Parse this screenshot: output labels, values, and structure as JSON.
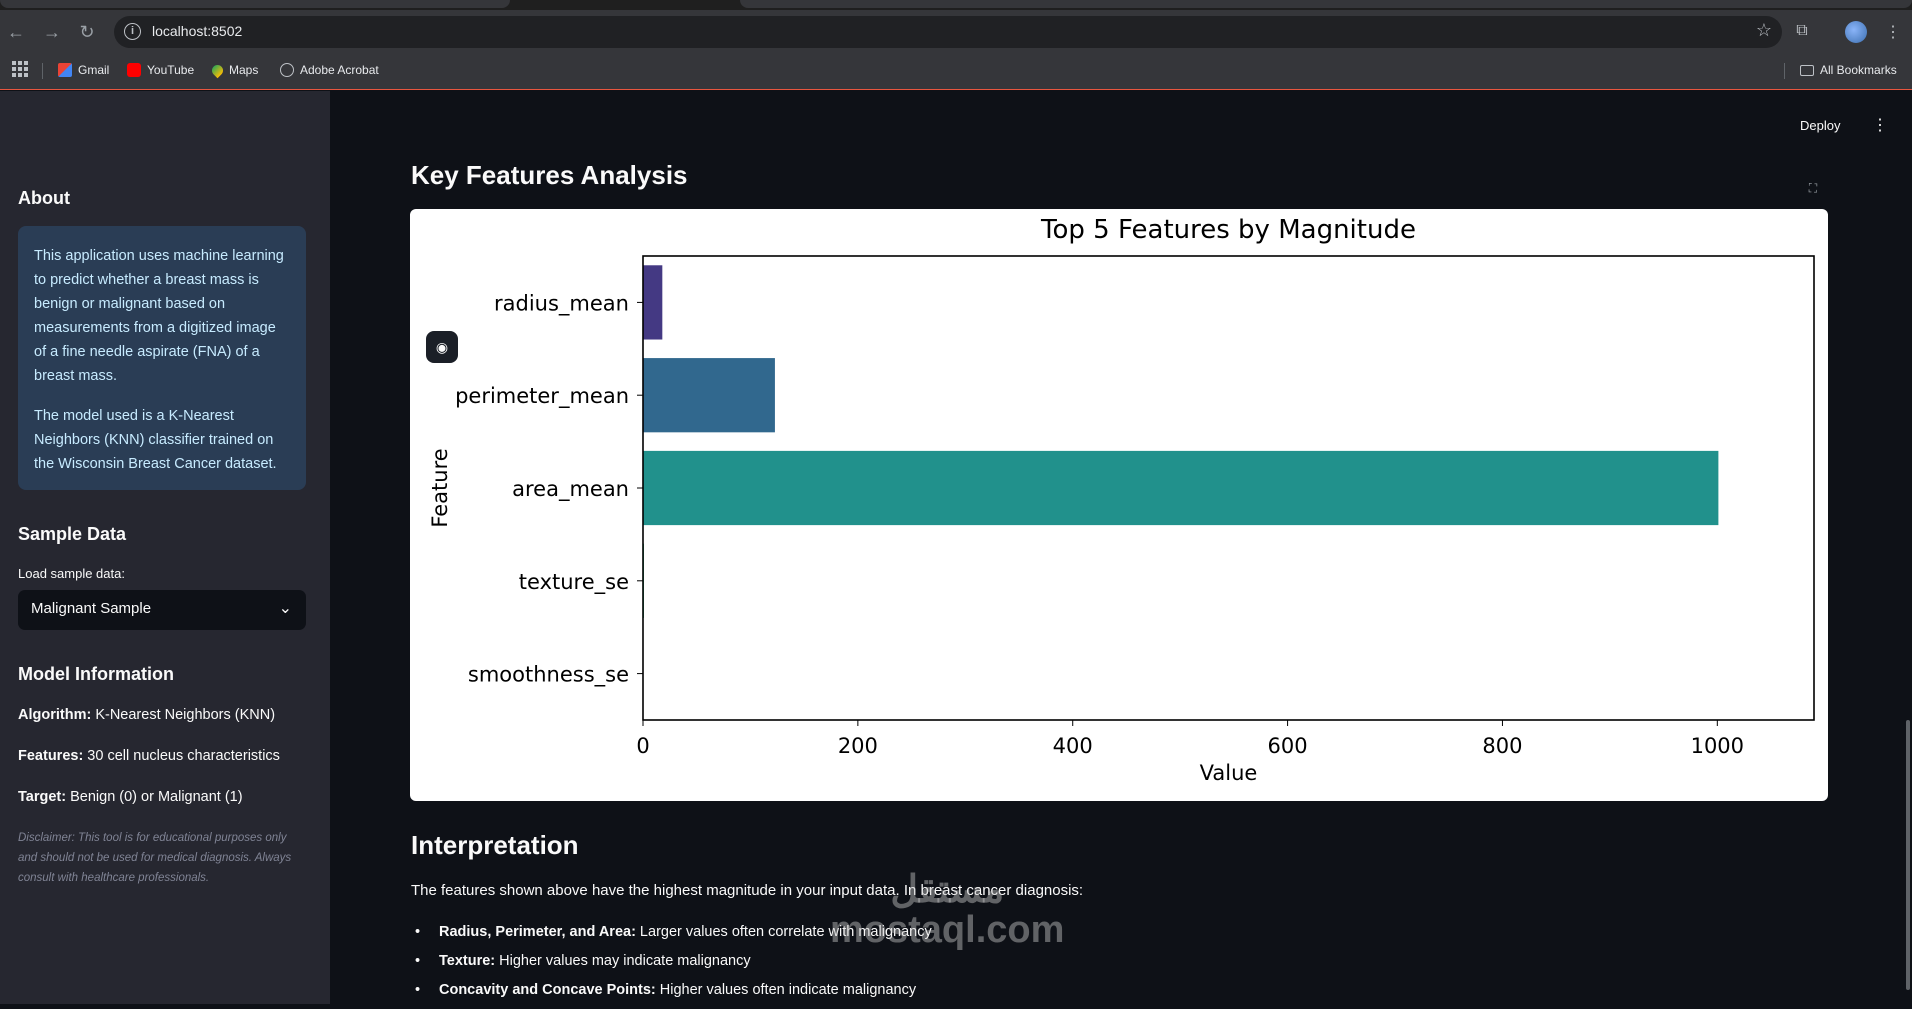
{
  "browser": {
    "url": "localhost:8502",
    "bookmarks": [
      "Gmail",
      "YouTube",
      "Maps",
      "Adobe Acrobat"
    ],
    "all_bookmarks": "All Bookmarks"
  },
  "header": {
    "deploy": "Deploy"
  },
  "sidebar": {
    "about_title": "About",
    "about_p1": "This application uses machine learning to predict whether a breast mass is benign or malignant based on measurements from a digitized image of a fine needle aspirate (FNA) of a breast mass.",
    "about_p2": "The model used is a K-Nearest Neighbors (KNN) classifier trained on the Wisconsin Breast Cancer dataset.",
    "sample_title": "Sample Data",
    "sample_label": "Load sample data:",
    "sample_value": "Malignant Sample",
    "model_title": "Model Information",
    "algorithm_label": "Algorithm:",
    "algorithm_value": " K-Nearest Neighbors (KNN)",
    "features_label": "Features:",
    "features_value": " 30 cell nucleus characteristics",
    "target_label": "Target:",
    "target_value": " Benign (0) or Malignant (1)",
    "disclaimer": "Disclaimer: This tool is for educational purposes only and should not be used for medical diagnosis. Always consult with healthcare professionals."
  },
  "main": {
    "key_features_title": "Key Features Analysis",
    "interpretation_title": "Interpretation",
    "interpretation_text": "The features shown above have the highest magnitude in your input data. In breast cancer diagnosis:",
    "bullets": [
      {
        "label": "Radius, Perimeter, and Area:",
        "text": " Larger values often correlate with malignancy"
      },
      {
        "label": "Texture:",
        "text": " Higher values may indicate malignancy"
      },
      {
        "label": "Concavity and Concave Points:",
        "text": " Higher values often indicate malignancy"
      }
    ]
  },
  "watermark": {
    "line1": "مستقل",
    "line2": "mostaql.com"
  },
  "chart_data": {
    "type": "bar",
    "orientation": "horizontal",
    "title": "Top 5 Features by Magnitude",
    "xlabel": "Value",
    "ylabel": "Feature",
    "categories": [
      "radius_mean",
      "perimeter_mean",
      "area_mean",
      "texture_se",
      "smoothness_se"
    ],
    "values": [
      17.99,
      122.8,
      1001,
      0.9053,
      0.006399
    ],
    "colors": [
      "#443983",
      "#31688e",
      "#21918c",
      "#35b779",
      "#90d743"
    ],
    "xlim": [
      0,
      1090
    ],
    "xticks": [
      0,
      200,
      400,
      600,
      800,
      1000
    ],
    "grid": false
  }
}
